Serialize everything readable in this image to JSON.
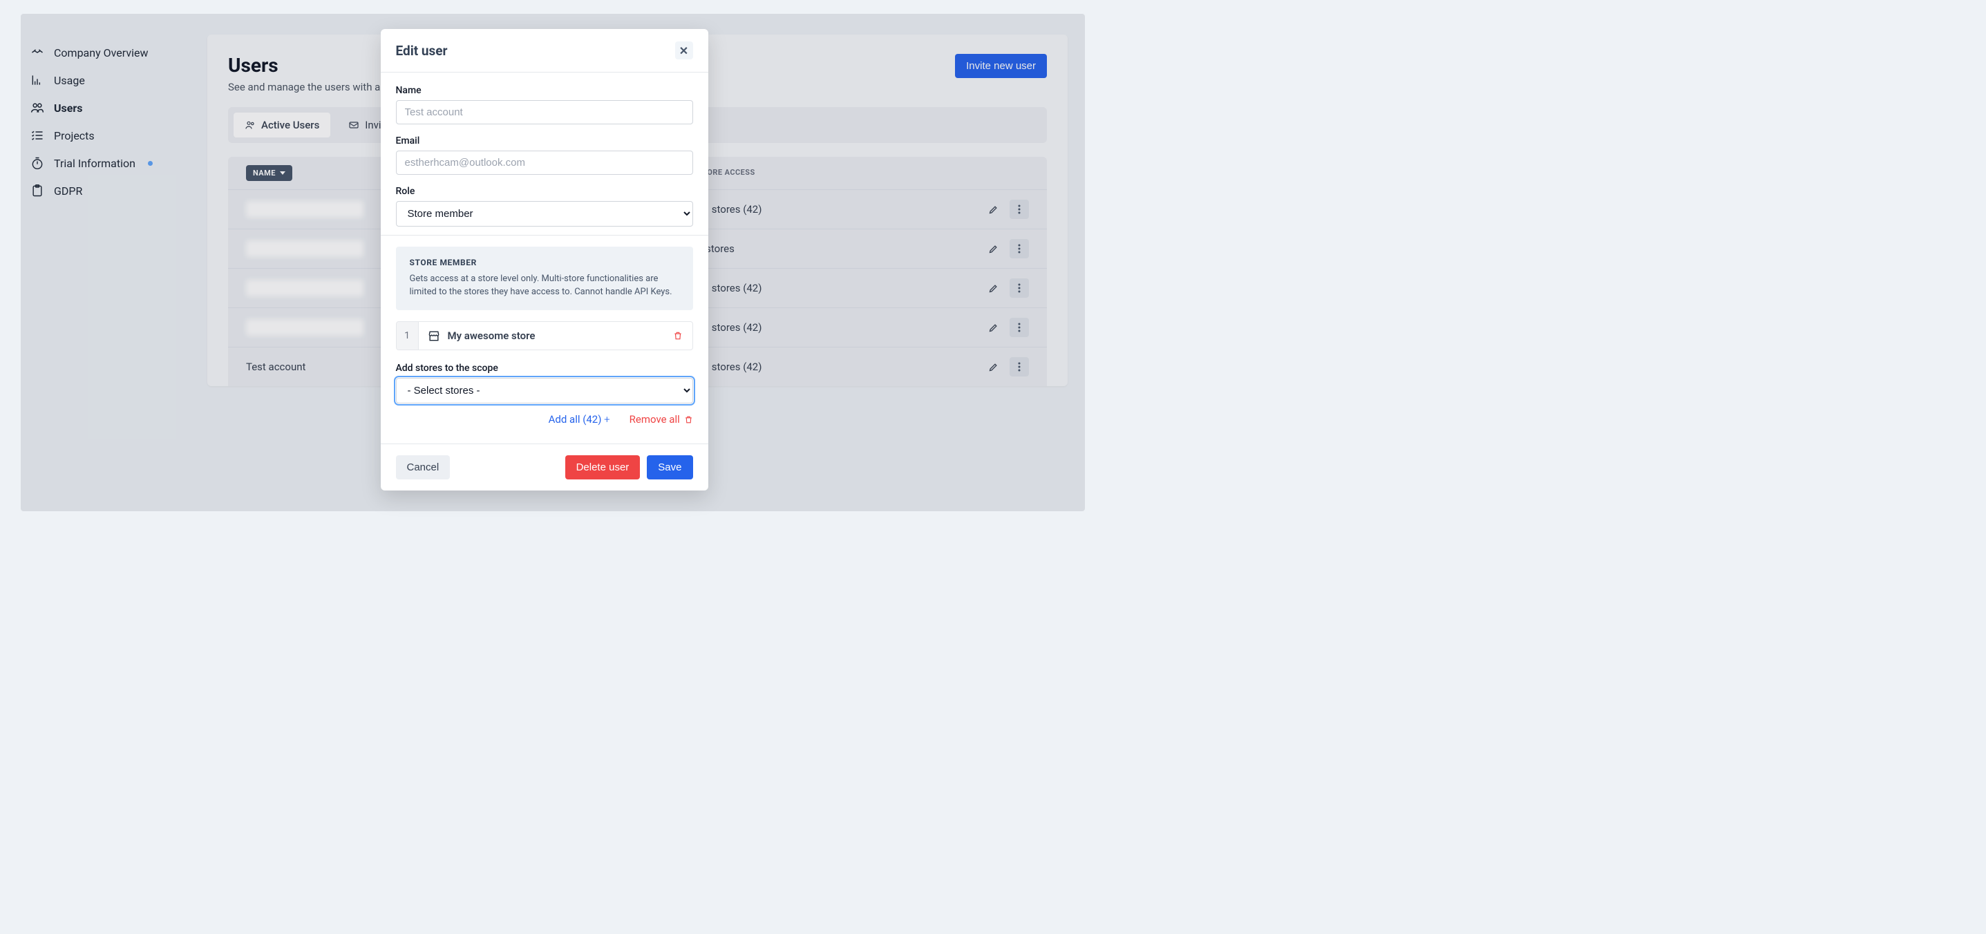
{
  "sidebar": {
    "items": [
      {
        "label": "Company Overview",
        "active": false,
        "dot": false
      },
      {
        "label": "Usage",
        "active": false,
        "dot": false
      },
      {
        "label": "Users",
        "active": true,
        "dot": false
      },
      {
        "label": "Projects",
        "active": false,
        "dot": false
      },
      {
        "label": "Trial Information",
        "active": false,
        "dot": true
      },
      {
        "label": "GDPR",
        "active": false,
        "dot": false
      }
    ]
  },
  "page": {
    "title": "Users",
    "subtitle": "See and manage the users with access to this account.",
    "invite_btn": "Invite new user",
    "tabs": {
      "active": "Active Users",
      "invited": "Invited Users"
    },
    "columns": {
      "name": "NAME",
      "store_access": "STORE ACCESS"
    },
    "rows": [
      {
        "name": "",
        "store_access": "All stores (42)"
      },
      {
        "name": "",
        "store_access": "3 stores"
      },
      {
        "name": "",
        "store_access": "All stores (42)"
      },
      {
        "name": "",
        "store_access": "All stores (42)"
      },
      {
        "name": "Test account",
        "store_access": "All stores (42)"
      }
    ]
  },
  "modal": {
    "title": "Edit user",
    "name_label": "Name",
    "name_placeholder": "Test account",
    "email_label": "Email",
    "email_placeholder": "estherhcam@outlook.com",
    "role_label": "Role",
    "role_value": "Store member",
    "info_title": "STORE MEMBER",
    "info_text": "Gets access at a store level only. Multi-store functionalities are limited to the stores they have access to. Cannot handle API Keys.",
    "store": {
      "index": "1",
      "name": "My awesome store"
    },
    "add_stores_label": "Add stores to the scope",
    "add_stores_placeholder": "- Select stores -",
    "add_all": "Add all (42)",
    "remove_all": "Remove all",
    "cancel": "Cancel",
    "delete": "Delete user",
    "save": "Save"
  }
}
